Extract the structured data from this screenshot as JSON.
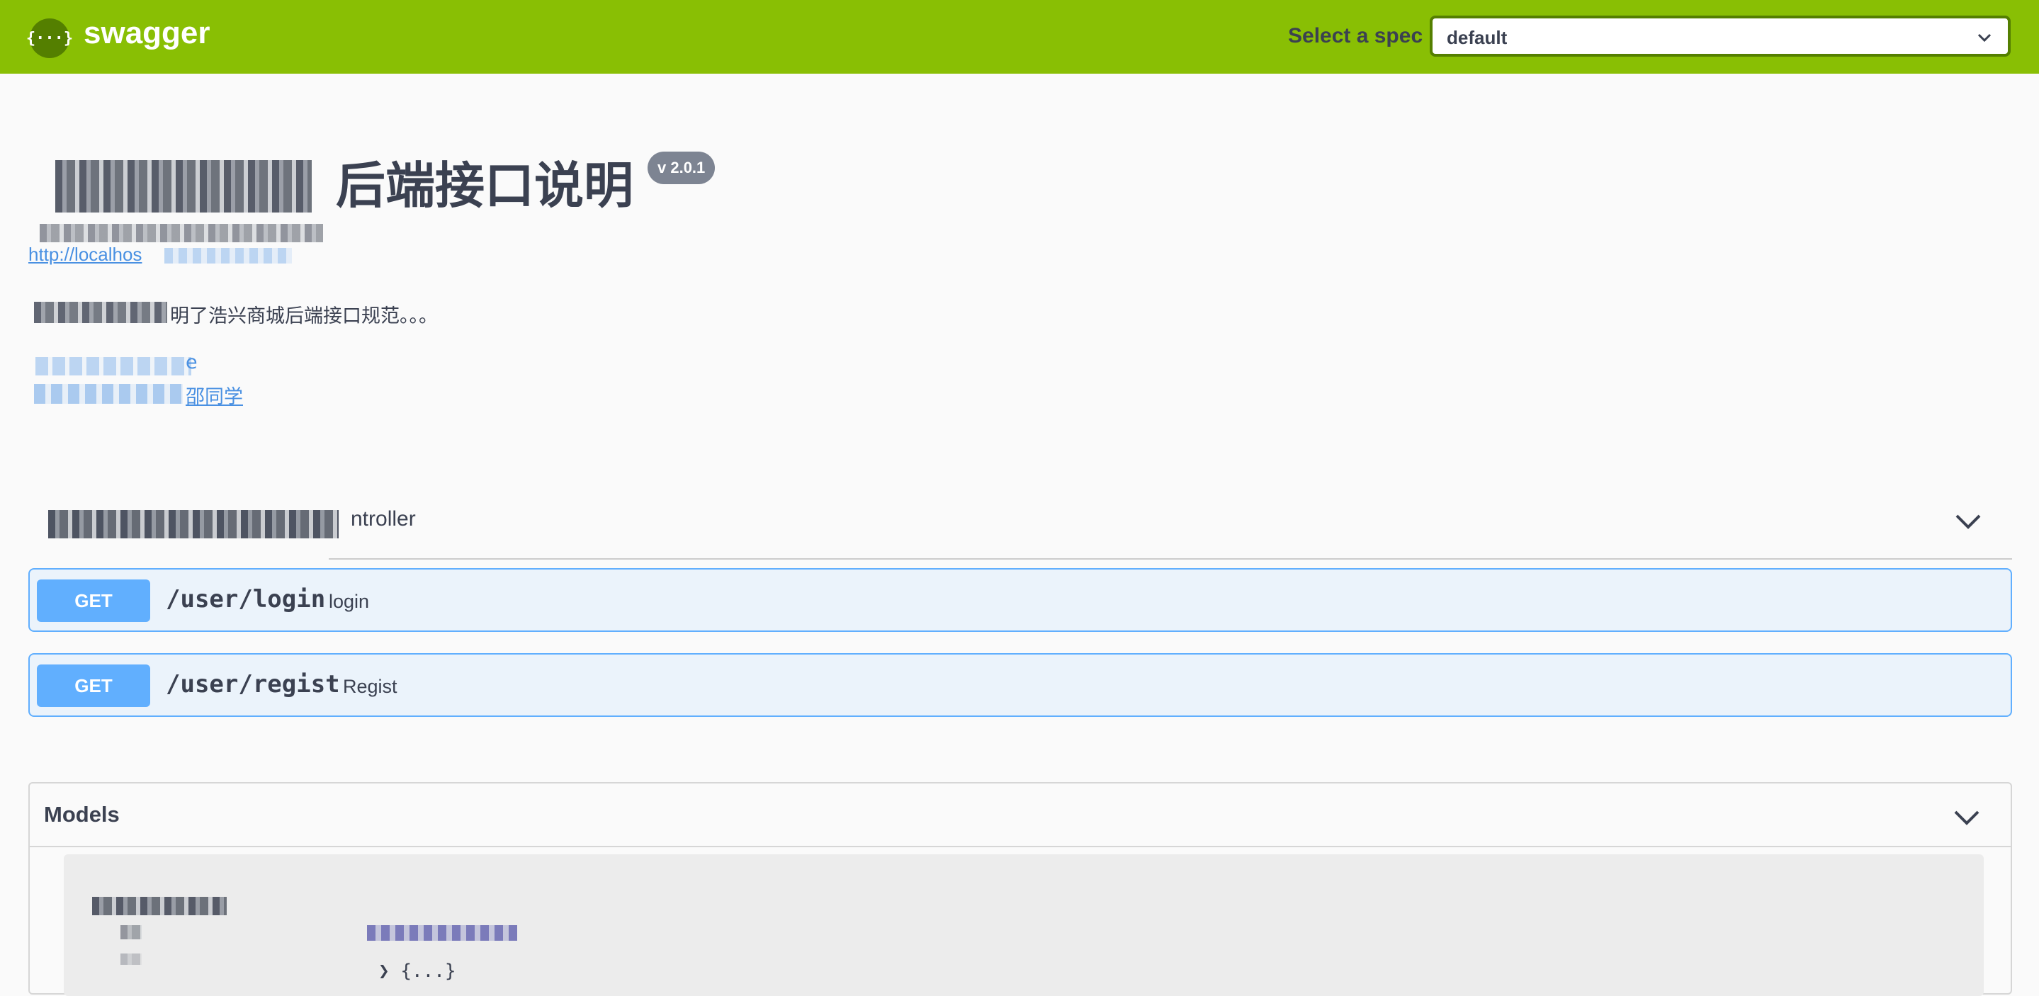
{
  "topbar": {
    "logo_glyph": "{···}",
    "brand": "swagger",
    "select_label": "Select a spec",
    "select_value": "default"
  },
  "info": {
    "title": "后端接口说明",
    "version": "v 2.0.1",
    "base_url": "http://localhos",
    "description": "明了浩兴商城后端接口规范。。。",
    "contact_suffix": "e",
    "author_suffix": "邵同学"
  },
  "tag": {
    "name_suffix": "ntroller"
  },
  "operations": [
    {
      "method": "GET",
      "path": "/user/login",
      "summary": "login"
    },
    {
      "method": "GET",
      "path": "/user/regist",
      "summary": "Regist"
    }
  ],
  "models": {
    "title": "Models",
    "expand_text": "{...}"
  },
  "colors": {
    "topbar": "#89bf04",
    "get_method": "#61affe",
    "get_bg": "#ebf3fb",
    "link": "#4990e2"
  }
}
